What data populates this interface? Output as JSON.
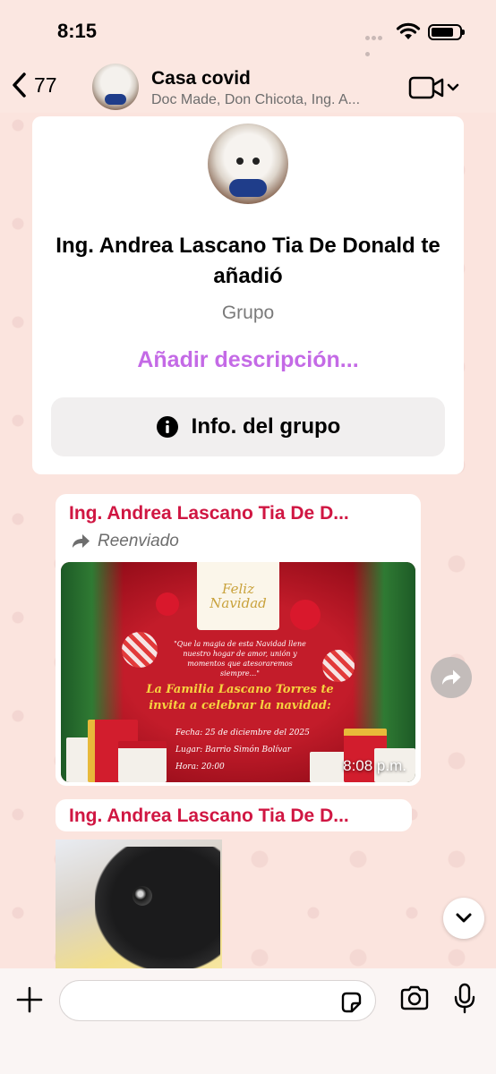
{
  "status_bar": {
    "time": "8:15"
  },
  "header": {
    "back_count": "77",
    "title": "Casa covid",
    "subtitle": "Doc Made, Don Chicota, Ing. A..."
  },
  "info_card": {
    "title": "Ing. Andrea Lascano Tia De Donald te añadió",
    "type": "Grupo",
    "add_description": "Añadir descripción...",
    "info_button": "Info. del grupo"
  },
  "messages": [
    {
      "sender": "Ing. Andrea Lascano Tia De D...",
      "forwarded_label": "Reenviado",
      "time": "8:08 p.m.",
      "flyer": {
        "header": "Feliz Navidad",
        "quote": "\"Que la magia de esta Navidad llene nuestro hogar de amor, unión y momentos que atesoraremos siempre...\"",
        "family_line1": "La Familia Lascano Torres te",
        "family_line2": "invita a celebrar la navidad:",
        "date": "Fecha: 25 de diciembre del 2025",
        "place": "Lugar: Barrio Simón Bolívar",
        "hour": "Hora: 20:00"
      }
    },
    {
      "sender": "Ing. Andrea Lascano Tia De D..."
    }
  ],
  "colors": {
    "sender": "#d01642",
    "accent_purple": "#c46ae6",
    "background": "#fbe4de"
  }
}
